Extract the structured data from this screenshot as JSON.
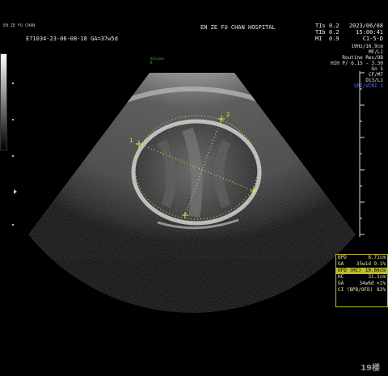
{
  "logo": {
    "text": "EN ZE FU CHAN"
  },
  "header": {
    "patient_id": "E71034-23-06-08-18  GA=37w5d",
    "hospital": "EN ZE FU CHAN HOSPITAL",
    "indices": [
      {
        "label": "TIs",
        "value": "0.2"
      },
      {
        "label": "TIb",
        "value": "0.2"
      },
      {
        "label": "MI",
        "value": "0.9"
      }
    ],
    "date": "2023/06/08",
    "time": "15:00:41",
    "probe": "C1-5-D"
  },
  "params": [
    "19Hz/16.9cm",
    "MF/L1",
    "Routine Res/OB",
    "HIH P/ 6.15 - 3.30",
    "Gn  5",
    "CF/M7",
    "D13/L1",
    "SRI/VCRI 1"
  ],
  "probe_mark": {
    "line1": "Voluson",
    "line2": "R"
  },
  "calipers": {
    "marker1": "1",
    "marker2": "2"
  },
  "measurements": [
    {
      "label": "BPD",
      "value": "8.71cm",
      "selected": false
    },
    {
      "label": "GA",
      "value": "35w1d 9.1%",
      "selected": false
    },
    {
      "label": "OFD (HC)",
      "value": "10.66cm",
      "selected": true
    },
    {
      "label": "HC",
      "value": "31.1cm",
      "selected": false
    },
    {
      "label": "GA",
      "value": "34w6d <1%",
      "selected": false
    },
    {
      "label": "CI (BPD/OFD)",
      "value": "82%",
      "selected": false
    }
  ],
  "watermark": "19楼",
  "colors": {
    "caliper": "#e8e83a",
    "panel_border": "#bcbc2a",
    "probe_mark": "#34d12b",
    "sri": "#4c78ff"
  }
}
